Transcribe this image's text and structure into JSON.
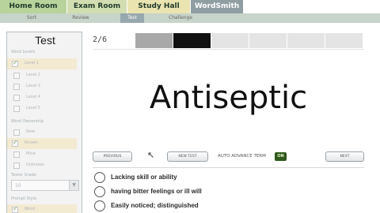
{
  "tabs": [
    {
      "label": "Home Room"
    },
    {
      "label": "Exam Room"
    },
    {
      "label": "Study Hall"
    },
    {
      "label": "WordSmith"
    }
  ],
  "subnav": [
    {
      "label": "Sort"
    },
    {
      "label": "Review"
    },
    {
      "label": "Test",
      "active": true
    },
    {
      "label": "Challenge"
    }
  ],
  "sidebar": {
    "title": "Test",
    "sections": {
      "word_levels": "Word Levels",
      "word_ownership": "Word Ownership",
      "tester_grade": "Tester Grade",
      "prompt_style": "Prompt Style"
    },
    "levels": [
      {
        "label": "Level 1",
        "checked": true,
        "selected": true
      },
      {
        "label": "Level 2",
        "checked": false
      },
      {
        "label": "Level 3",
        "checked": false
      },
      {
        "label": "Level 4",
        "checked": false
      },
      {
        "label": "Level 5",
        "checked": false
      }
    ],
    "ownership": [
      {
        "label": "New",
        "checked": false
      },
      {
        "label": "Known",
        "checked": true,
        "selected": true
      },
      {
        "label": "Mine",
        "checked": false
      },
      {
        "label": "Unknown",
        "checked": false
      }
    ],
    "grade_value": "10",
    "prompt": [
      {
        "label": "Word",
        "checked": true,
        "selected": true
      }
    ]
  },
  "test": {
    "counter": "2/6",
    "progress_segments": 6,
    "current_index": 2,
    "word": "Antiseptic",
    "auto_advance_label": "AUTO ADVANCE TERM",
    "auto_advance_state": "ON"
  },
  "controls": {
    "previous": "PREVIOUS",
    "new_test": "NEW TEST",
    "next": "NEXT"
  },
  "answers": [
    "Lacking skill or ability",
    "having bitter feelings or ill will",
    "Easily noticed; distinguished"
  ],
  "colors": {
    "progress_done": "#a8a8a8",
    "progress_current": "#111111",
    "progress_todo": "#e4e4e4",
    "toggle_on": "#2f5a1c"
  }
}
